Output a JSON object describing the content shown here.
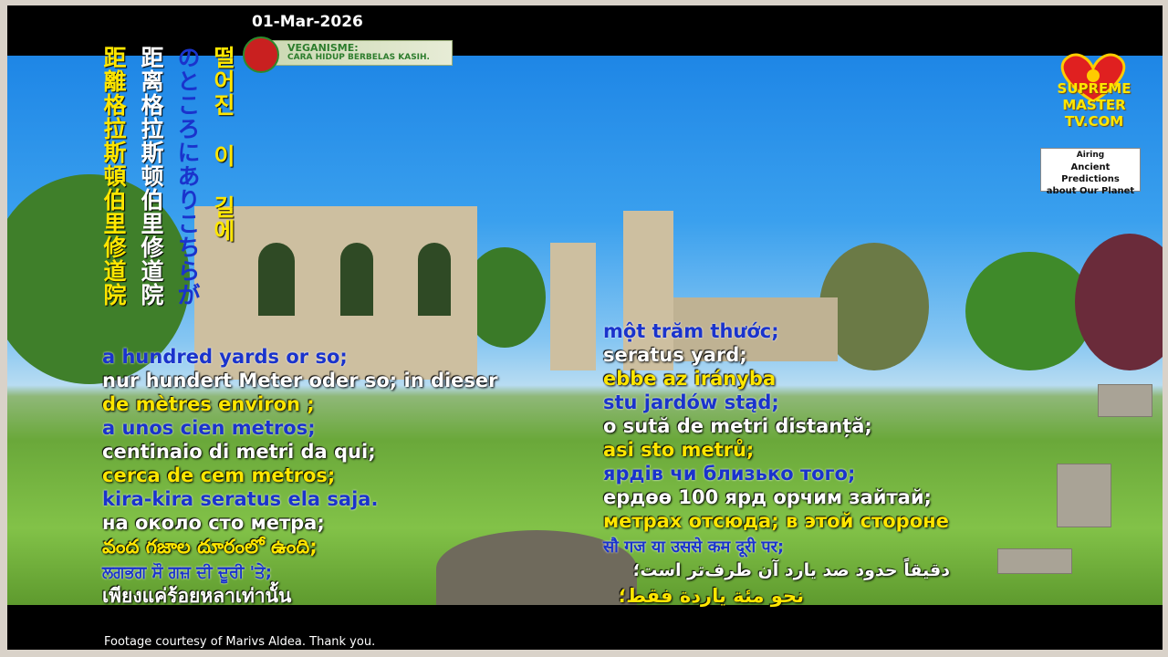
{
  "header": {
    "date": "01-Mar-2026"
  },
  "banner": {
    "line1": "VEGANISME:",
    "line2": "CARA HIDUP BERBELAS KASIH."
  },
  "logo": {
    "line1": "SUPREME MASTER",
    "line2": "TV.COM"
  },
  "airing": {
    "label": "Airing",
    "title_line1": "Ancient Predictions",
    "title_line2": "about Our Planet"
  },
  "vertical_subtitles": [
    {
      "text": "距離格拉斯頓伯里修道院",
      "lang": "zh-Hant"
    },
    {
      "text": "距离格拉斯顿伯里修道院",
      "lang": "zh-Hans"
    },
    {
      "text": "のところにありこちらが",
      "lang": "ja"
    },
    {
      "text": "떨어진 이 길에",
      "lang": "ko"
    }
  ],
  "left_subtitles": [
    {
      "text": "a hundred yards or so;",
      "color": "blue"
    },
    {
      "text": "nur hundert Meter oder so; in dieser",
      "color": "white"
    },
    {
      "text": "de mètres environ ;",
      "color": "yellow"
    },
    {
      "text": "a unos cien metros;",
      "color": "blue"
    },
    {
      "text": "centinaio di metri da qui;",
      "color": "white"
    },
    {
      "text": "cerca de cem metros;",
      "color": "yellow"
    },
    {
      "text": "kira-kira seratus ela saja.",
      "color": "blue"
    },
    {
      "text": "на около сто метра;",
      "color": "white"
    },
    {
      "text": "వంద గజాల దూరంలో ఉంది;",
      "color": "yellow"
    },
    {
      "text": "ਲਗਭਗ ਸੌ ਗਜ਼ ਦੀ ਦੂਰੀ 'ਤੇ;",
      "color": "blue"
    },
    {
      "text": "เพียงแค่ร้อยหลาเท่านั้น",
      "color": "white"
    }
  ],
  "right_subtitles": [
    {
      "text": "một trăm thước;",
      "color": "blue"
    },
    {
      "text": "seratus yard;",
      "color": "white"
    },
    {
      "text": "ebbe az irányba",
      "color": "yellow"
    },
    {
      "text": "stu jardów stąd;",
      "color": "blue"
    },
    {
      "text": "o sută de metri distanță;",
      "color": "white"
    },
    {
      "text": "asi sto metrů;",
      "color": "yellow"
    },
    {
      "text": "ярдів чи близько того;",
      "color": "blue"
    },
    {
      "text": "ердөө 100 ярд орчим зайтай;",
      "color": "white"
    },
    {
      "text": "метрах отсюда; в этой стороне",
      "color": "yellow"
    },
    {
      "text": "सौ गज या उससे कम दूरी पर;",
      "color": "blue"
    },
    {
      "text": "دقیقاً حدود صد یارد آن طرف‌تر است؛",
      "color": "white"
    },
    {
      "text": "نحو مئة ياردة فقط؛",
      "color": "yellow"
    }
  ],
  "footer": {
    "credit": "Footage courtesy of Marivs Aldea. Thank you."
  }
}
